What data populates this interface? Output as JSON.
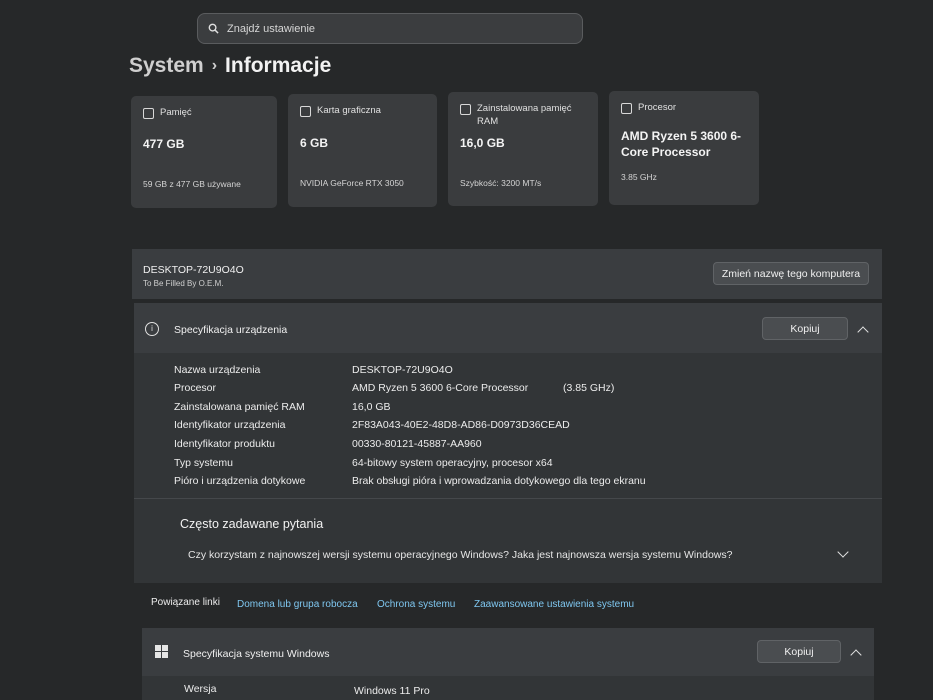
{
  "search": {
    "placeholder": "Znajdź ustawienie"
  },
  "breadcrumb": {
    "parent": "System",
    "current": "Informacje"
  },
  "cards": [
    {
      "label": "Pamięć",
      "value": "477 GB",
      "sub": "59 GB z 477 GB używane",
      "icon": "storage-icon"
    },
    {
      "label": "Karta graficzna",
      "value": "6 GB",
      "sub": "NVIDIA GeForce RTX 3050",
      "icon": "gpu-icon"
    },
    {
      "label": "Zainstalowana pamięć RAM",
      "value": "16,0 GB",
      "sub": "Szybkość: 3200 MT/s",
      "icon": "ram-icon"
    },
    {
      "label": "Procesor",
      "value": "AMD Ryzen 5 3600 6-Core Processor",
      "sub": "3.85 GHz",
      "icon": "processor-icon"
    }
  ],
  "computer": {
    "name": "DESKTOP-72U9O4O",
    "model": "To Be Filled By O.E.M.",
    "rename_button": "Zmień nazwę tego komputera"
  },
  "device_specs": {
    "title": "Specyfikacja urządzenia",
    "copy_button": "Kopiuj",
    "rows": [
      {
        "label": "Nazwa urządzenia",
        "value": "DESKTOP-72U9O4O",
        "extra": ""
      },
      {
        "label": "Procesor",
        "value": "AMD Ryzen 5 3600 6-Core Processor",
        "extra": "(3.85 GHz)"
      },
      {
        "label": "Zainstalowana pamięć RAM",
        "value": "16,0 GB",
        "extra": ""
      },
      {
        "label": "Identyfikator urządzenia",
        "value": "2F83A043-40E2-48D8-AD86-D0973D36CEAD",
        "extra": ""
      },
      {
        "label": "Identyfikator produktu",
        "value": "00330-80121-45887-AA960",
        "extra": ""
      },
      {
        "label": "Typ systemu",
        "value": "64-bitowy system operacyjny, procesor x64",
        "extra": ""
      },
      {
        "label": "Pióro i urządzenia dotykowe",
        "value": "Brak obsługi pióra i wprowadzania dotykowego dla tego ekranu",
        "extra": ""
      }
    ]
  },
  "faq": {
    "title": "Często zadawane pytania",
    "question": "Czy korzystam z najnowszej wersji systemu operacyjnego Windows? Jaka jest najnowsza wersja systemu Windows?"
  },
  "related_links": {
    "label": "Powiązane linki",
    "links": [
      "Domena lub grupa robocza",
      "Ochrona systemu",
      "Zaawansowane ustawienia systemu"
    ]
  },
  "windows_specs": {
    "title": "Specyfikacja systemu Windows",
    "copy_button": "Kopiuj",
    "rows": [
      {
        "label": "Wersja",
        "value": "Windows 11 Pro"
      }
    ]
  }
}
